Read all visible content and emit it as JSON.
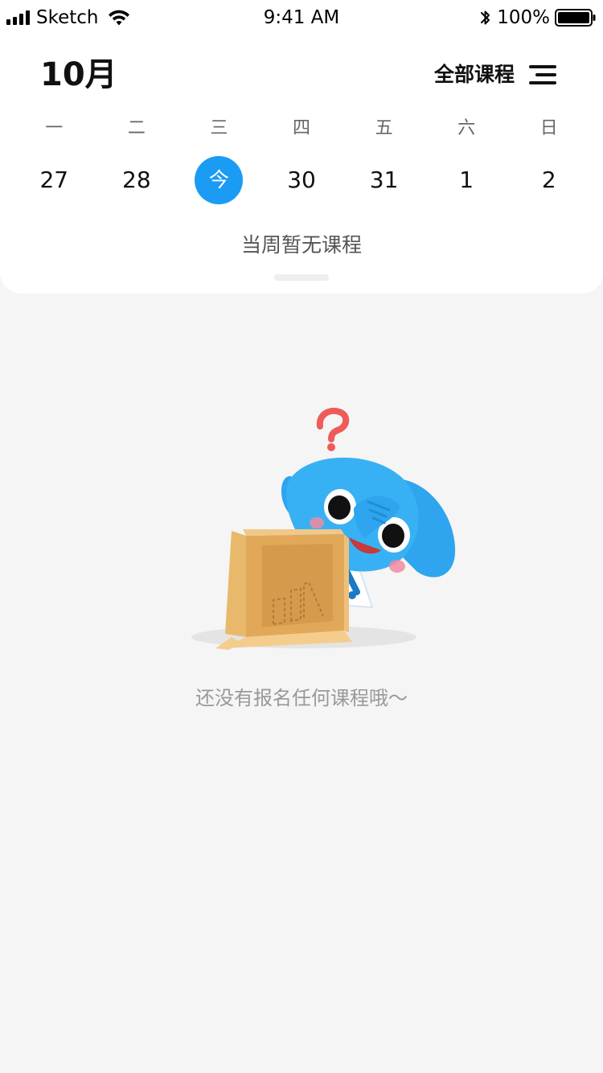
{
  "status_bar": {
    "carrier": "Sketch",
    "time": "9:41 AM",
    "battery_percent": "100%",
    "icons": [
      "signal-icon",
      "wifi-icon",
      "bluetooth-icon",
      "battery-icon"
    ]
  },
  "header": {
    "month": "10月",
    "all_courses_label": "全部课程",
    "menu_icon": "menu-icon"
  },
  "calendar": {
    "weekdays": [
      "一",
      "二",
      "三",
      "四",
      "五",
      "六",
      "日"
    ],
    "dates": [
      "27",
      "28",
      "今",
      "30",
      "31",
      "1",
      "2"
    ],
    "today_index": 2,
    "today_color": "#1a9cf5"
  },
  "week_notice": "当周暂无课程",
  "empty_state": {
    "message": "还没有报名任何课程哦～",
    "illustration": "elephant-with-box-illustration"
  },
  "colors": {
    "accent": "#1a9cf5",
    "background": "#f5f5f5",
    "panel": "#ffffff"
  }
}
